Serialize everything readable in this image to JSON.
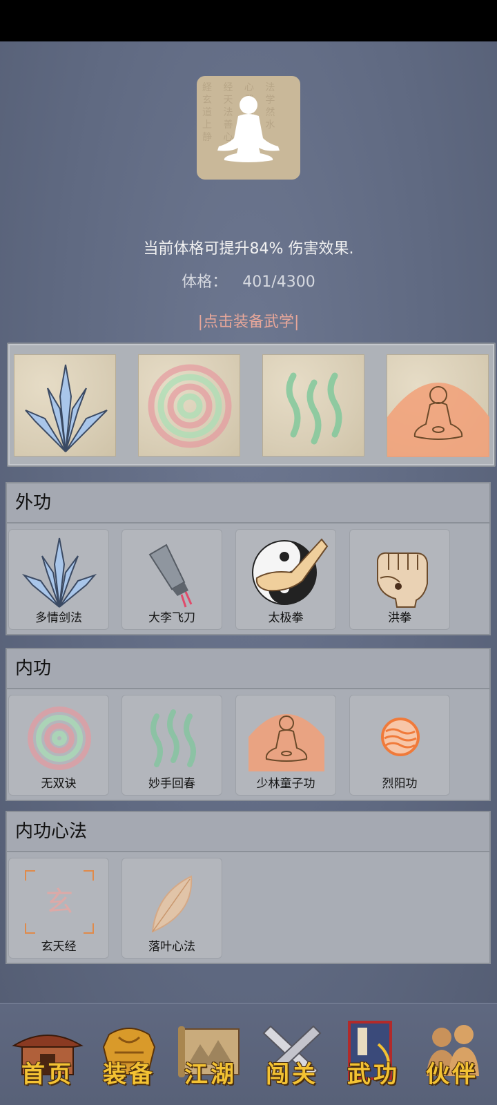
{
  "info": {
    "physique_effect": "当前体格可提升84% 伤害效果.",
    "physique_label": "体格：",
    "physique_value": "401/4300",
    "equip_link": "|点击装备武学|"
  },
  "equipped_slots": [
    "sword-burst-icon",
    "spiral-icon",
    "waves-icon",
    "meditating-monk-icon"
  ],
  "sections": {
    "external": {
      "title": "外功",
      "skills": [
        {
          "name": "多情剑法",
          "icon": "sword-burst-icon"
        },
        {
          "name": "大李飞刀",
          "icon": "flying-knife-icon"
        },
        {
          "name": "太极拳",
          "icon": "taiji-fist-icon"
        },
        {
          "name": "洪拳",
          "icon": "fist-icon"
        }
      ]
    },
    "internal": {
      "title": "内功",
      "skills": [
        {
          "name": "无双诀",
          "icon": "spiral-icon"
        },
        {
          "name": "妙手回春",
          "icon": "waves-icon"
        },
        {
          "name": "少林童子功",
          "icon": "meditating-monk-icon"
        },
        {
          "name": "烈阳功",
          "icon": "sun-orb-icon"
        }
      ]
    },
    "mind": {
      "title": "内功心法",
      "skills": [
        {
          "name": "玄天经",
          "icon": "xuan-seal-icon",
          "seal_char": "玄"
        },
        {
          "name": "落叶心法",
          "icon": "leaf-icon"
        }
      ]
    }
  },
  "nav": [
    {
      "label": "首页",
      "icon": "temple-icon"
    },
    {
      "label": "装备",
      "icon": "armor-icon"
    },
    {
      "label": "江湖",
      "icon": "scroll-map-icon"
    },
    {
      "label": "闯关",
      "icon": "crossed-swords-icon"
    },
    {
      "label": "武功",
      "icon": "manual-book-icon"
    },
    {
      "label": "伙伴",
      "icon": "companions-icon"
    }
  ],
  "colors": {
    "background": "#5f6981",
    "equip_link": "#e8a79a",
    "nav_label": "#f3c233"
  }
}
